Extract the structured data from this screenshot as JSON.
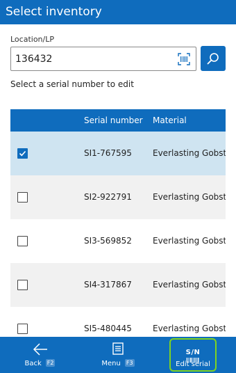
{
  "header": {
    "title": "Select inventory"
  },
  "form": {
    "field_label": "Location/LP",
    "field_value": "136432",
    "instruction": "Select a serial number to edit"
  },
  "icons": {
    "scan": "barcode-scan-icon",
    "search": "search-icon",
    "back": "arrow-left-icon",
    "menu": "menu-document-icon",
    "edit_serial": "serial-number-icon"
  },
  "table": {
    "columns": [
      "Serial number",
      "Material"
    ],
    "rows": [
      {
        "serial": "SI1-767595",
        "material": "Everlasting Gobstop",
        "checked": true
      },
      {
        "serial": "SI2-922791",
        "material": "Everlasting Gobstop",
        "checked": false
      },
      {
        "serial": "SI3-569852",
        "material": "Everlasting Gobstop",
        "checked": false
      },
      {
        "serial": "SI4-317867",
        "material": "Everlasting Gobstop",
        "checked": false
      },
      {
        "serial": "SI5-480445",
        "material": "Everlasting Gobstop",
        "checked": false
      }
    ]
  },
  "bottom_bar": {
    "back": {
      "label": "Back",
      "key": "F2"
    },
    "menu": {
      "label": "Menu",
      "key": "F3"
    },
    "edit_serial": {
      "label": "Edit serial",
      "icon_text": "S/N"
    }
  },
  "colors": {
    "primary": "#0f6cbd",
    "selected_row": "#cfe4f1",
    "alt_row": "#f1f1f1",
    "highlight_border": "#7ed321"
  }
}
